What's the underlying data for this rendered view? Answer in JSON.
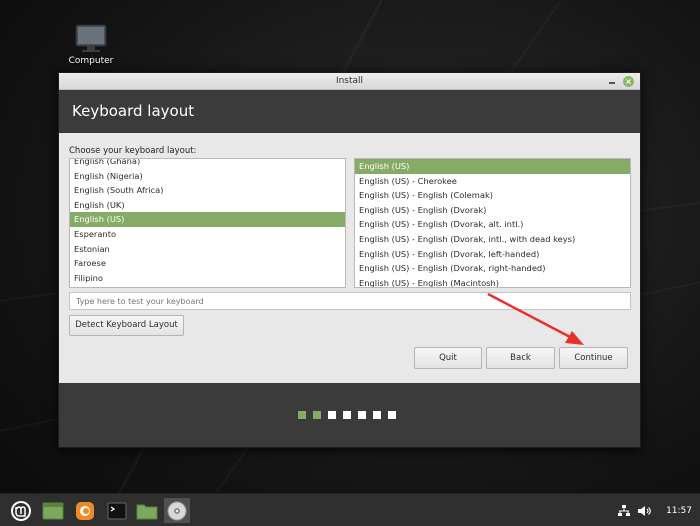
{
  "desktop": {
    "computer_label": "Computer"
  },
  "window": {
    "title": "Install",
    "heading": "Keyboard layout",
    "choose_label": "Choose your keyboard layout:",
    "layouts": [
      "English (Ghana)",
      "English (Nigeria)",
      "English (South Africa)",
      "English (UK)",
      "English (US)",
      "Esperanto",
      "Estonian",
      "Faroese",
      "Filipino"
    ],
    "selected_layout": "English (US)",
    "variants": [
      "English (US)",
      "English (US) - Cherokee",
      "English (US) - English (Colemak)",
      "English (US) - English (Dvorak)",
      "English (US) - English (Dvorak, alt. intl.)",
      "English (US) - English (Dvorak, intl., with dead keys)",
      "English (US) - English (Dvorak, left-handed)",
      "English (US) - English (Dvorak, right-handed)",
      "English (US) - English (Macintosh)"
    ],
    "selected_variant": "English (US)",
    "test_placeholder": "Type here to test your keyboard",
    "detect_label": "Detect Keyboard Layout",
    "quit_label": "Quit",
    "back_label": "Back",
    "continue_label": "Continue",
    "progress": {
      "completed_steps": 2,
      "total_steps": 7
    }
  },
  "taskbar": {
    "apps": [
      "mint-menu-icon",
      "show-desktop-icon",
      "firefox-icon",
      "terminal-icon",
      "files-icon",
      "installer-icon"
    ],
    "clock": "11:57"
  },
  "colors": {
    "accent": "#86ab66",
    "header_bg": "#3b3b3b",
    "annotation_arrow": "#e8302a"
  }
}
